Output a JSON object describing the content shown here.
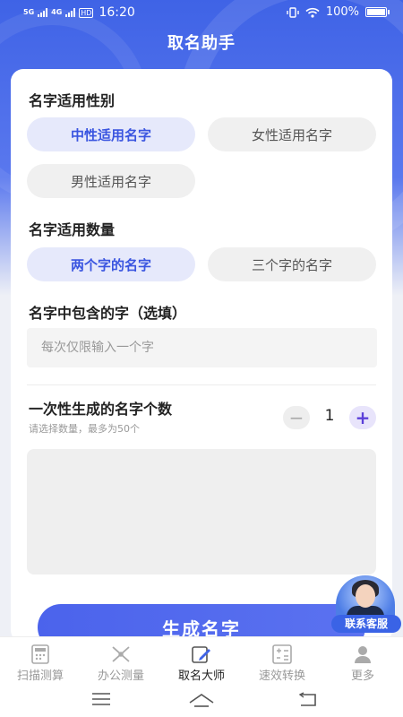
{
  "status_bar": {
    "signal_1": "5G",
    "signal_2": "4G",
    "hd": "HD",
    "time": "16:20",
    "battery": "100%"
  },
  "header": {
    "title": "取名助手"
  },
  "gender_section": {
    "label": "名字适用性别",
    "options": [
      "中性适用名字",
      "女性适用名字",
      "男性适用名字"
    ],
    "selected_index": 0
  },
  "length_section": {
    "label": "名字适用数量",
    "options": [
      "两个字的名字",
      "三个字的名字"
    ],
    "selected_index": 0
  },
  "char_section": {
    "label": "名字中包含的字（选填）",
    "input_value": "",
    "placeholder": "每次仅限输入一个字"
  },
  "count_section": {
    "label": "一次性生成的名字个数",
    "hint": "请选择数量，最多为50个",
    "value": "1",
    "minus": "−",
    "plus": "+"
  },
  "result": {
    "text": ""
  },
  "generate_button": {
    "label": "生成名字"
  },
  "service": {
    "label": "联系客服"
  },
  "tabbar": {
    "items": [
      {
        "label": "扫描测算",
        "icon": "scan-calculator-icon"
      },
      {
        "label": "办公测量",
        "icon": "ruler-tools-icon"
      },
      {
        "label": "取名大师",
        "icon": "pen-edit-icon"
      },
      {
        "label": "速效转换",
        "icon": "calculator-convert-icon"
      },
      {
        "label": "更多",
        "icon": "user-more-icon"
      }
    ],
    "active_index": 2
  },
  "colors": {
    "accent": "#3f63e6",
    "chip_active_bg": "#e6e9fb",
    "chip_active_text": "#3a55e0",
    "chip_bg": "#f0f0f0",
    "plus_color": "#5b3fd9"
  }
}
